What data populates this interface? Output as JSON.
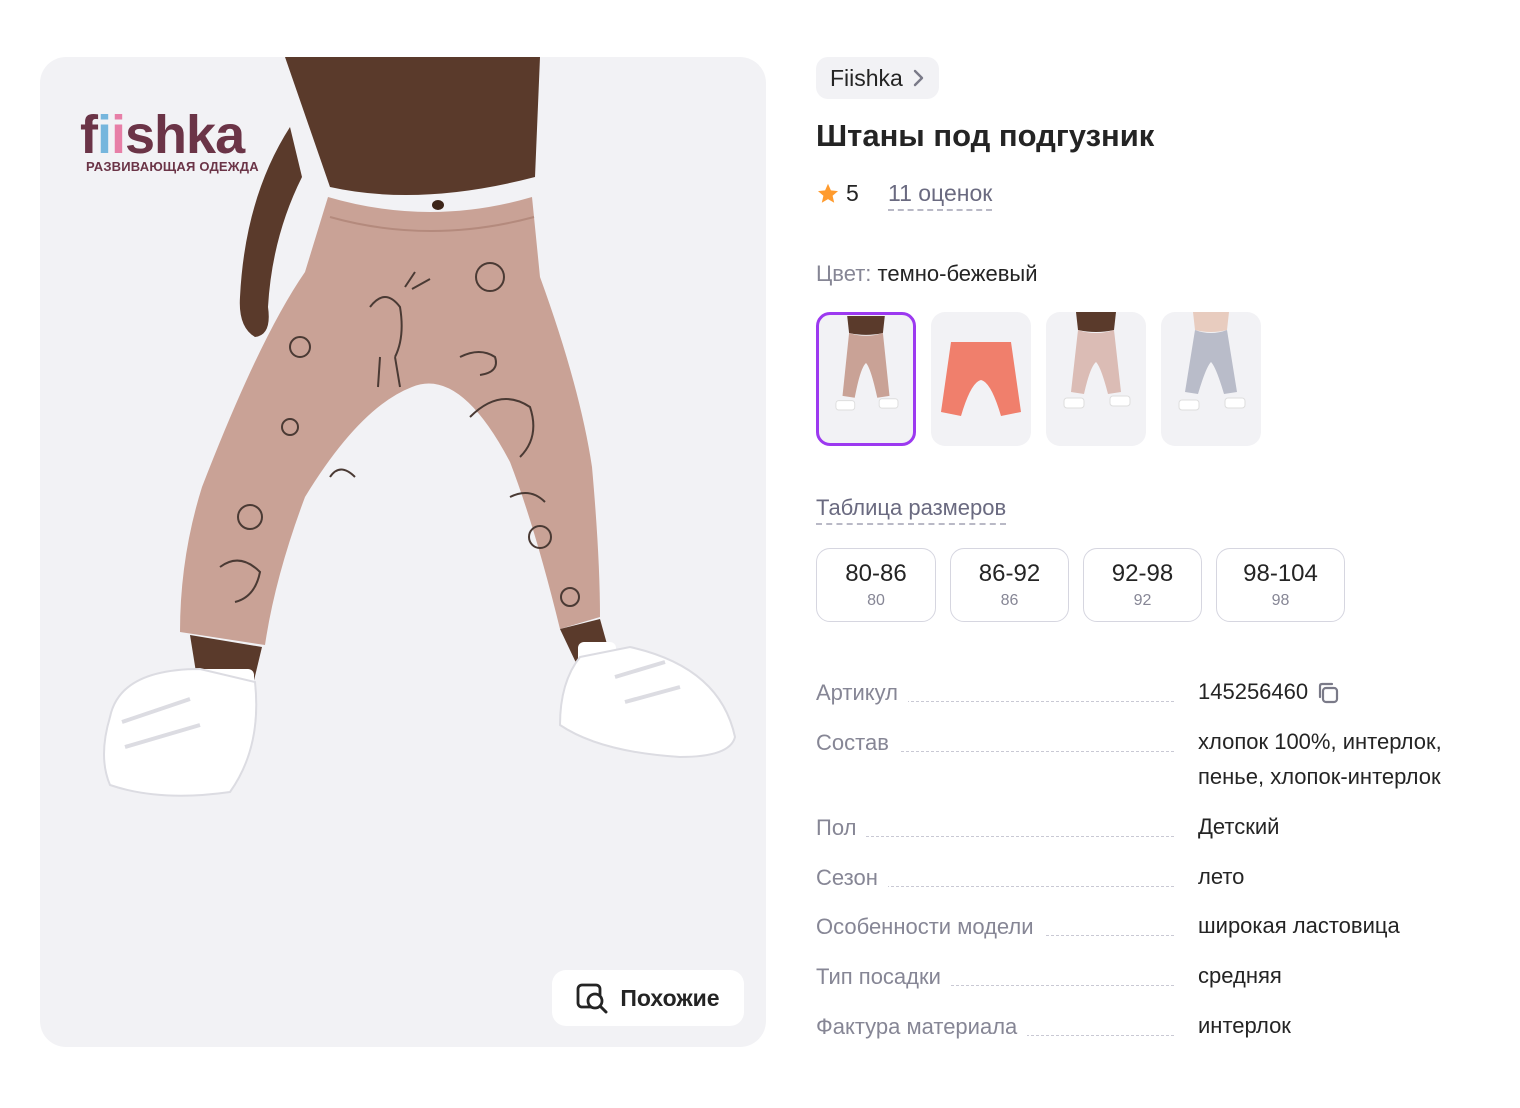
{
  "photo": {
    "logo": {
      "word": "fiishka",
      "tagline": "РАЗВИВАЮЩАЯ ОДЕЖДА"
    },
    "similar_button": "Похожие",
    "pants_color": "#c9a296"
  },
  "brand": {
    "name": "Fiishka"
  },
  "product": {
    "title": "Штаны под подгузник"
  },
  "rating": {
    "score": "5",
    "reviews": "11 оценок",
    "star_color": "#ff9b2e"
  },
  "color": {
    "label": "Цвет:",
    "value": "темно-бежевый"
  },
  "swatches": [
    {
      "name": "swatch-dark-beige",
      "color": "#c9a296",
      "active": true
    },
    {
      "name": "swatch-coral",
      "color": "#f07f6c",
      "active": false
    },
    {
      "name": "swatch-light-pink",
      "color": "#dbbcb5",
      "active": false
    },
    {
      "name": "swatch-grey",
      "color": "#b9bcc9",
      "active": false
    }
  ],
  "size_table_link": "Таблица размеров",
  "sizes": [
    {
      "main": "80-86",
      "sub": "80"
    },
    {
      "main": "86-92",
      "sub": "86"
    },
    {
      "main": "92-98",
      "sub": "92"
    },
    {
      "main": "98-104",
      "sub": "98"
    }
  ],
  "specs": [
    {
      "key": "Артикул",
      "value": "145256460"
    },
    {
      "key": "Состав",
      "value": "хлопок 100%, интерлок, пенье, хлопок-интерлок"
    },
    {
      "key": "Пол",
      "value": "Детский"
    },
    {
      "key": "Сезон",
      "value": "лето"
    },
    {
      "key": "Особенности модели",
      "value": "широкая ластовица"
    },
    {
      "key": "Тип посадки",
      "value": "средняя"
    },
    {
      "key": "Фактура материала",
      "value": "интерлок"
    }
  ],
  "accent_color": "#9c39f0"
}
